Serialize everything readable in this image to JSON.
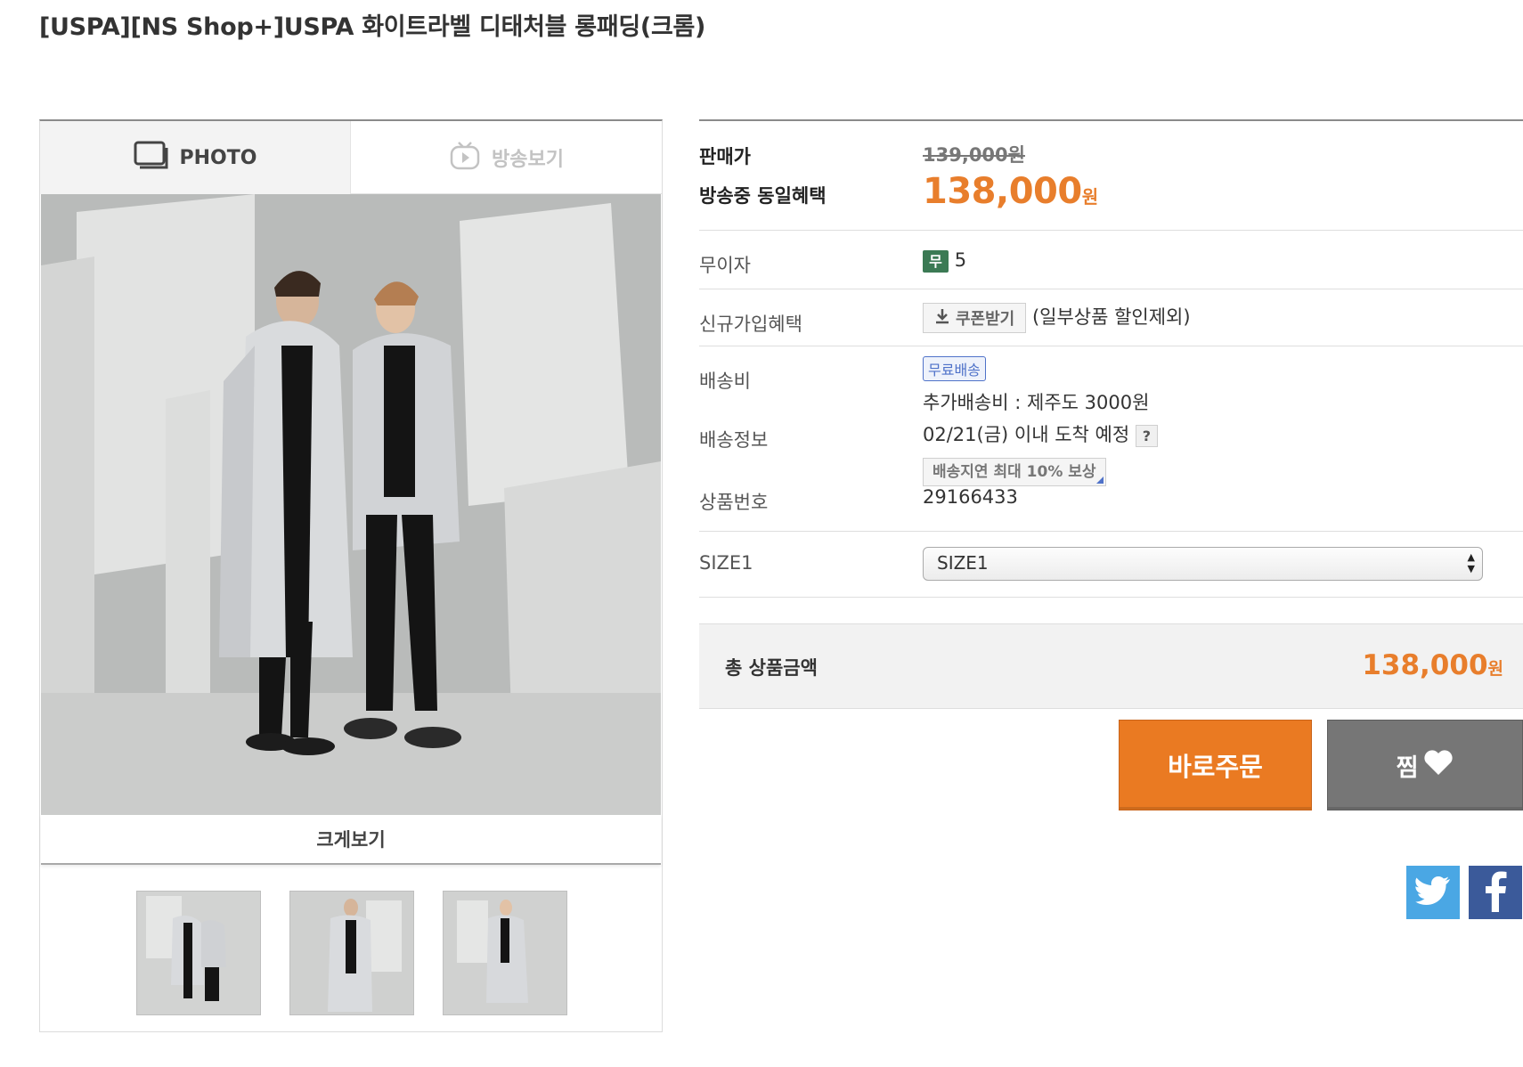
{
  "product": {
    "title": "[USPA][NS Shop+]USPA 화이트라벨 디태처블 롱패딩(크롬)"
  },
  "gallery": {
    "tabs": [
      {
        "label": "PHOTO",
        "icon": "photo-icon",
        "active": true
      },
      {
        "label": "방송보기",
        "icon": "tv-play-icon",
        "active": false
      }
    ],
    "zoom_label": "크게보기",
    "thumbnails": [
      "couple-front",
      "man-front",
      "woman-front"
    ]
  },
  "info": {
    "price_label": "판매가",
    "original_price": "139,000원",
    "benefit_label": "방송중 동일혜택",
    "sale_price": "138,000",
    "sale_currency": "원",
    "installment_label": "무이자",
    "installment_badge": "무",
    "installment_months": "5",
    "signup_label": "신규가입혜택",
    "coupon_button": "쿠폰받기",
    "coupon_note": "(일부상품 할인제외)",
    "shipping_label": "배송비",
    "free_shipping_badge": "무료배송",
    "extra_shipping": "추가배송비 : 제주도 3000원",
    "delivery_label": "배송정보",
    "delivery_date": "02/21(금) 이내 도착 예정",
    "help_icon_text": "?",
    "delay_compensation": "배송지연 최대 10% 보상",
    "product_no_label": "상품번호",
    "product_no": "29166433",
    "option_label": "SIZE1",
    "option_selected": "SIZE1",
    "total_label": "총 상품금액",
    "total_price": "138,000",
    "total_currency": "원",
    "buy_button": "바로주문",
    "wish_button": "찜"
  },
  "social": {
    "twitter_icon": "twitter-icon",
    "facebook_icon": "facebook-icon"
  },
  "colors": {
    "accent_orange": "#ea7a22",
    "price_orange": "#e87e2c",
    "wish_gray": "#767676",
    "installment_green": "#3b7a54",
    "free_shipping_blue": "#4f72c9"
  }
}
